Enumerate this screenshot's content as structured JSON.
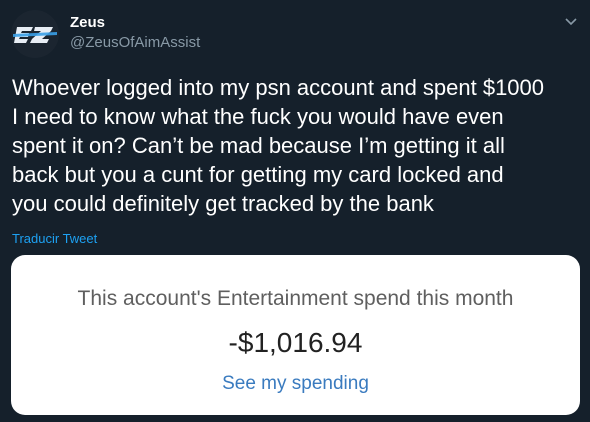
{
  "author": {
    "name": "Zeus",
    "handle": "@ZeusOfAimAssist",
    "avatar_icon": "ez-logo-avatar"
  },
  "tweet": {
    "text": "Whoever logged into my psn account and spent $1000\nI need to know what the fuck you would have even\nspent it on? Can’t be mad because I’m getting it all\nback but you a cunt for getting my card locked  and\nyou could definitely get tracked by the bank",
    "translate_label": "Traducir Tweet"
  },
  "media": {
    "title": "This account's Entertainment spend this month",
    "amount": "-$1,016.94",
    "link_label": "See my spending"
  },
  "menu_icon": "chevron-down-icon",
  "colors": {
    "background": "#15202b",
    "text": "#ffffff",
    "muted": "#8899a6",
    "link": "#1da1f2",
    "card_link": "#3a7bbf"
  }
}
